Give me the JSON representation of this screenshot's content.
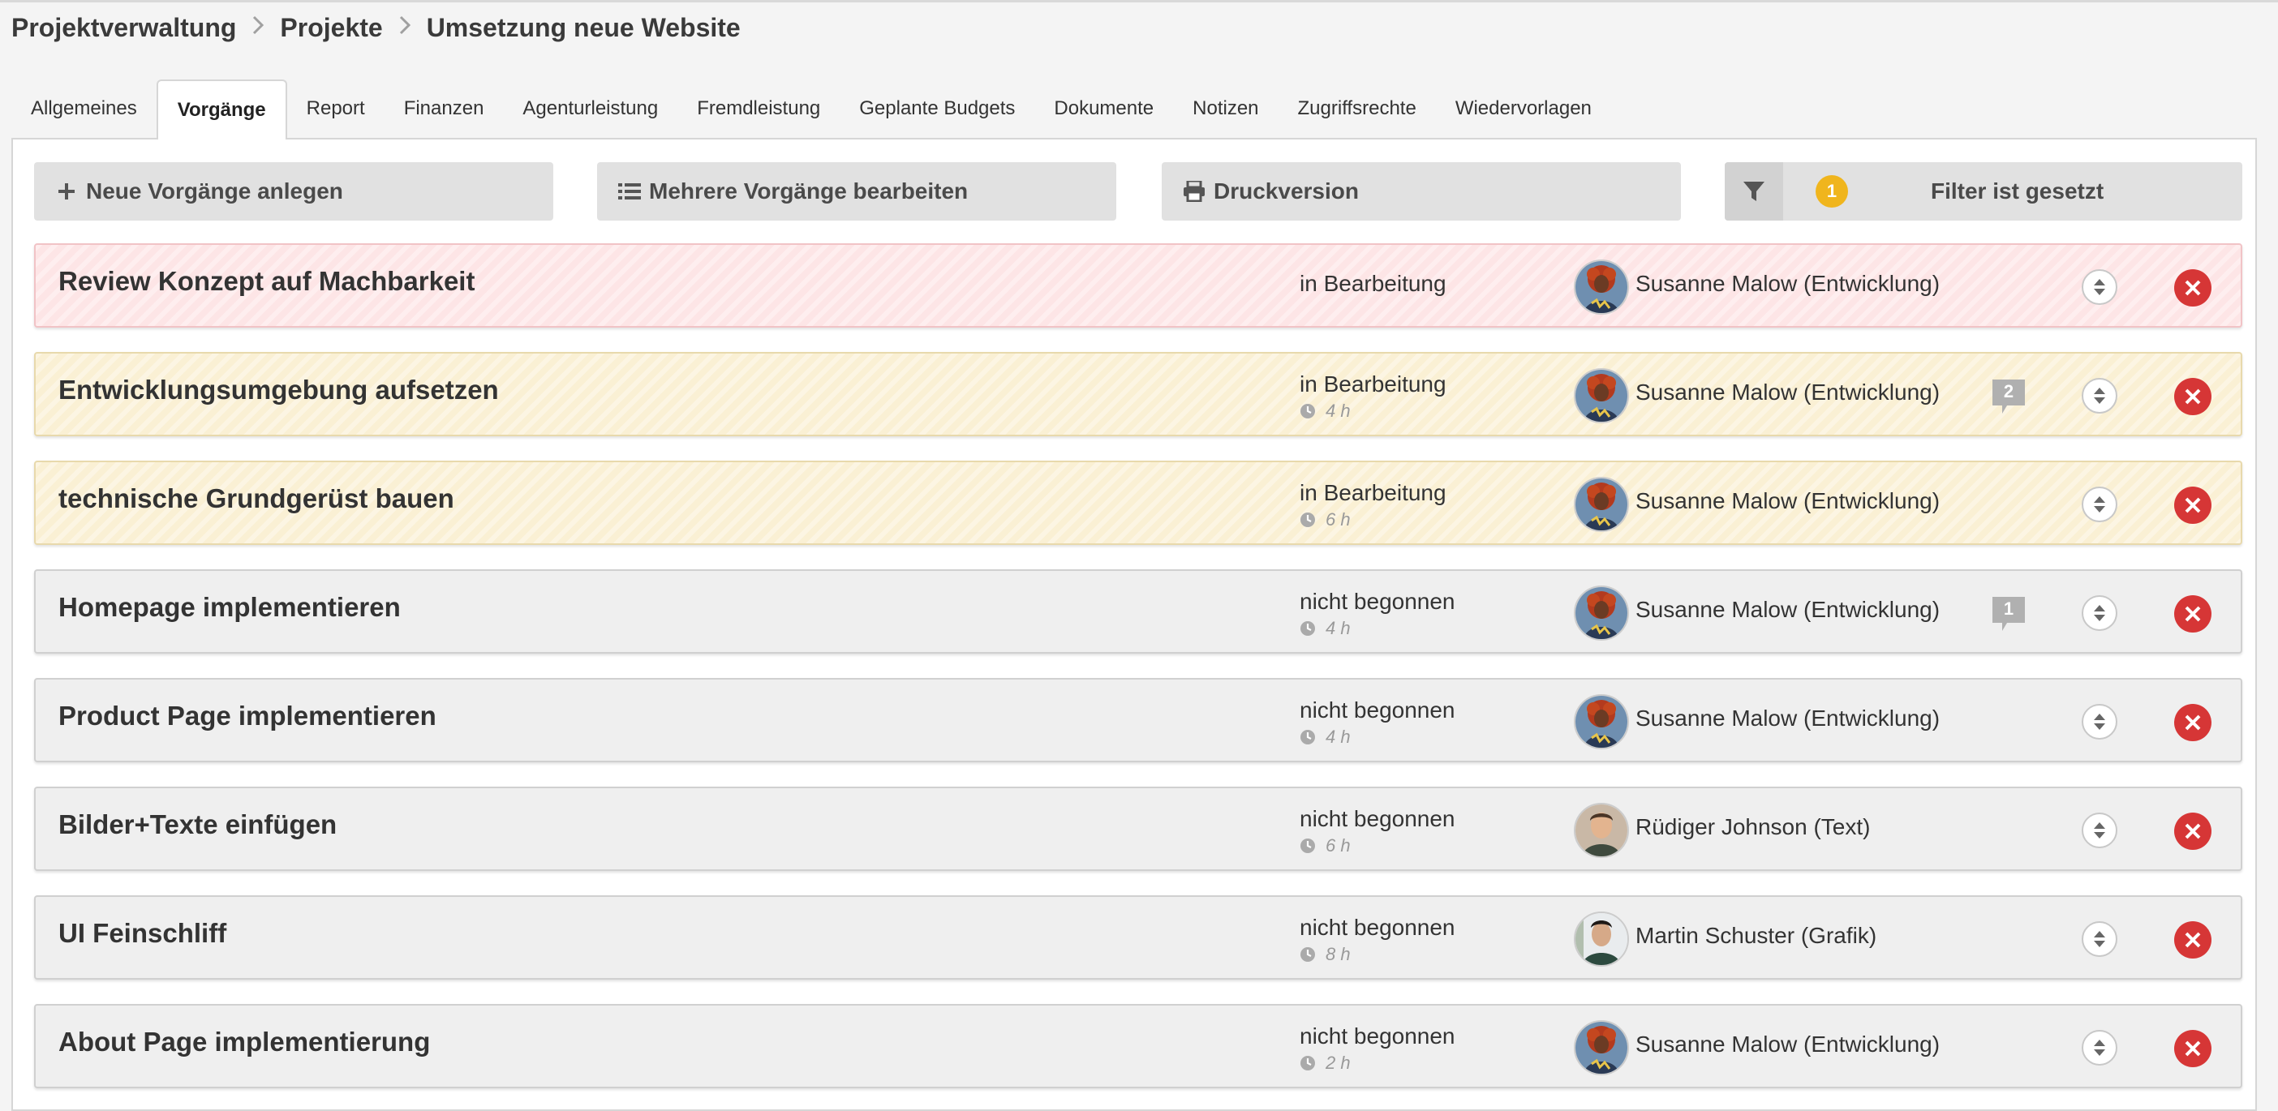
{
  "breadcrumb": [
    "Projektverwaltung",
    "Projekte",
    "Umsetzung neue Website"
  ],
  "tabs": [
    {
      "label": "Allgemeines",
      "active": false
    },
    {
      "label": "Vorgänge",
      "active": true
    },
    {
      "label": "Report",
      "active": false
    },
    {
      "label": "Finanzen",
      "active": false
    },
    {
      "label": "Agenturleistung",
      "active": false
    },
    {
      "label": "Fremdleistung",
      "active": false
    },
    {
      "label": "Geplante Budgets",
      "active": false
    },
    {
      "label": "Dokumente",
      "active": false
    },
    {
      "label": "Notizen",
      "active": false
    },
    {
      "label": "Zugriffsrechte",
      "active": false
    },
    {
      "label": "Wiedervorlagen",
      "active": false
    }
  ],
  "toolbar": {
    "new_label": "Neue Vorgänge anlegen",
    "multi_label": "Mehrere Vorgänge bearbeiten",
    "print_label": "Druckversion",
    "filter_count": "1",
    "filter_label": "Filter ist gesetzt"
  },
  "colors": {
    "red_row": "#fde5e6",
    "yellow_row": "#faf0d4",
    "neutral_row": "#efefef",
    "delete": "#d63636",
    "badge": "#f0b51d"
  },
  "tasks": [
    {
      "title": "Review Konzept auf Machbarkeit",
      "status": "in Bearbeitung",
      "hours": "",
      "assignee": "Susanne Malow (Entwicklung)",
      "avatar": "susanne",
      "comments": "",
      "color": "red"
    },
    {
      "title": "Entwicklungsumgebung aufsetzen",
      "status": "in Bearbeitung",
      "hours": "4 h",
      "assignee": "Susanne Malow (Entwicklung)",
      "avatar": "susanne",
      "comments": "2",
      "color": "yellow"
    },
    {
      "title": "technische Grundgerüst bauen",
      "status": "in Bearbeitung",
      "hours": "6 h",
      "assignee": "Susanne Malow (Entwicklung)",
      "avatar": "susanne",
      "comments": "",
      "color": "yellow"
    },
    {
      "title": "Homepage implementieren",
      "status": "nicht begonnen",
      "hours": "4 h",
      "assignee": "Susanne Malow (Entwicklung)",
      "avatar": "susanne",
      "comments": "1",
      "color": "neutral"
    },
    {
      "title": "Product Page implementieren",
      "status": "nicht begonnen",
      "hours": "4 h",
      "assignee": "Susanne Malow (Entwicklung)",
      "avatar": "susanne",
      "comments": "",
      "color": "neutral"
    },
    {
      "title": "Bilder+Texte einfügen",
      "status": "nicht begonnen",
      "hours": "6 h",
      "assignee": "Rüdiger Johnson (Text)",
      "avatar": "ruediger",
      "comments": "",
      "color": "neutral"
    },
    {
      "title": "UI Feinschliff",
      "status": "nicht begonnen",
      "hours": "8 h",
      "assignee": "Martin Schuster (Grafik)",
      "avatar": "martin",
      "comments": "",
      "color": "neutral"
    },
    {
      "title": "About Page implementierung",
      "status": "nicht begonnen",
      "hours": "2 h",
      "assignee": "Susanne Malow (Entwicklung)",
      "avatar": "susanne",
      "comments": "",
      "color": "neutral"
    }
  ]
}
